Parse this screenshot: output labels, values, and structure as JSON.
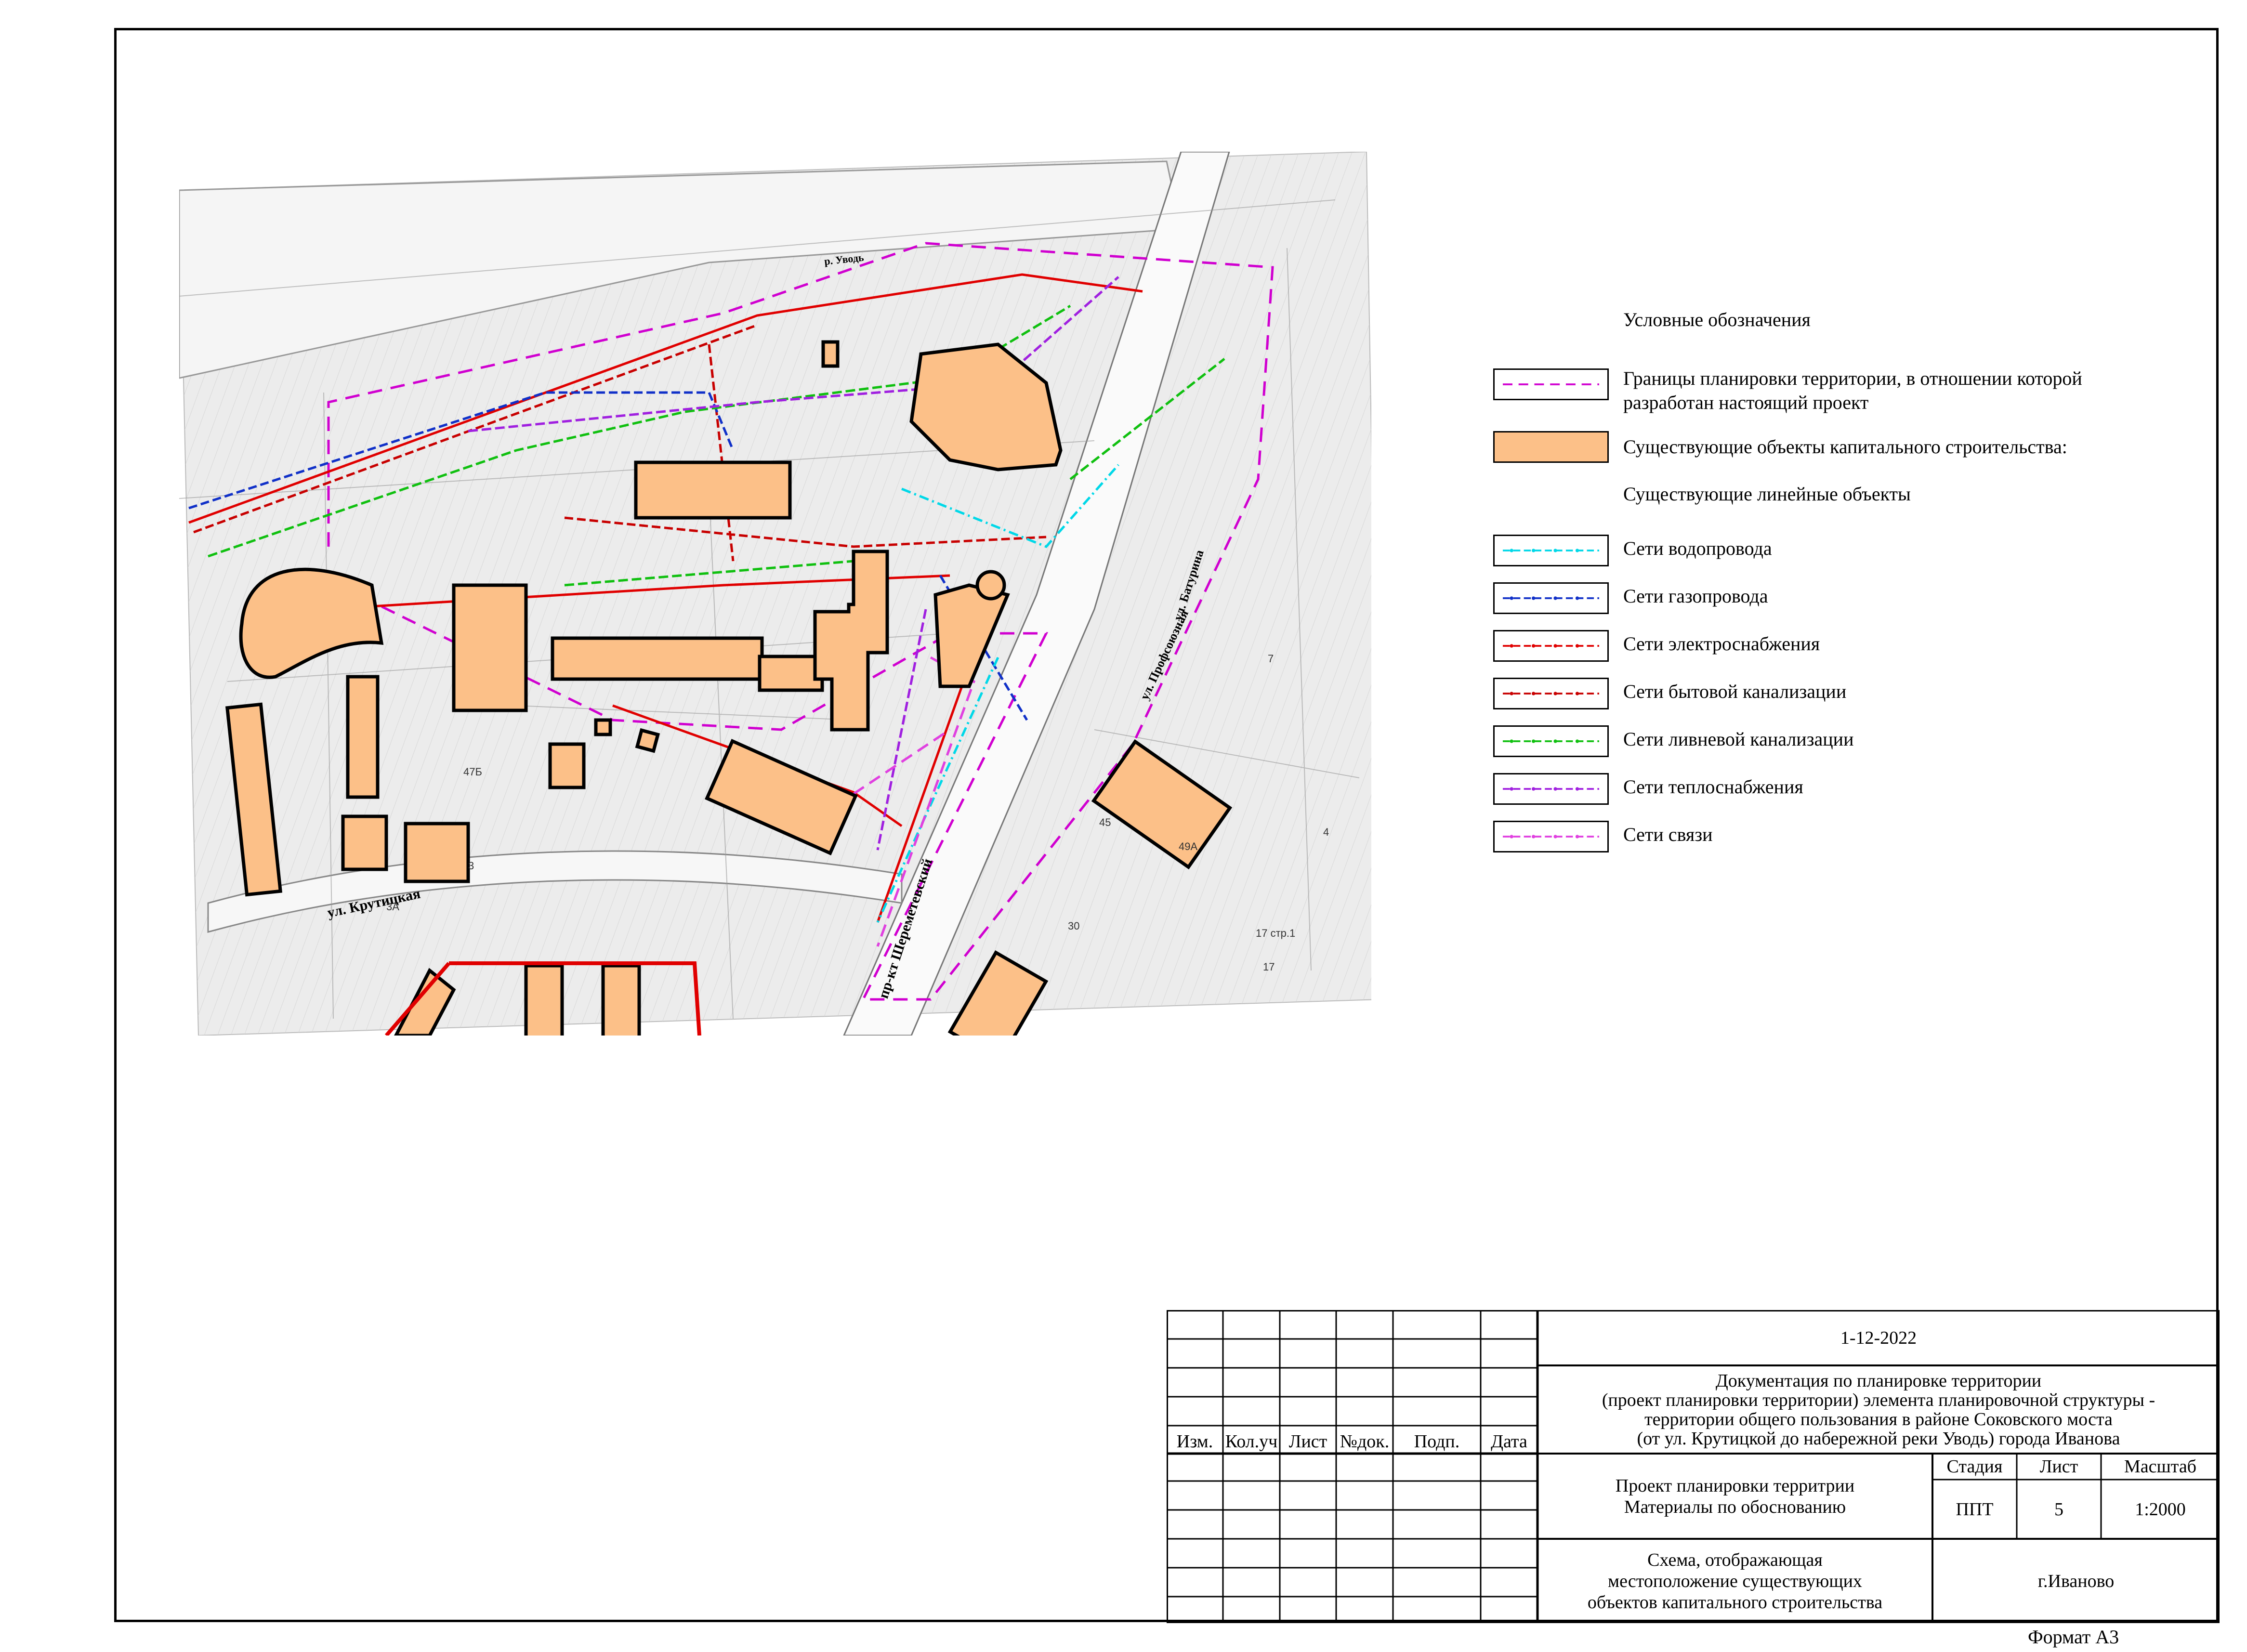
{
  "legend": {
    "title": "Условные обозначения",
    "items": [
      {
        "label": "Границы планировки территории, в отношении которой разработан настоящий проект",
        "style": "boundary",
        "color": "#d000d0"
      },
      {
        "label": "Существующие объекты капитального строительства:",
        "style": "fill",
        "color": "#fcc088"
      }
    ],
    "subtitle": "Существующие линейные объекты",
    "networks": [
      {
        "label": "Сети водопровода",
        "color": "#00d8e8"
      },
      {
        "label": "Сети газопровода",
        "color": "#1030c8"
      },
      {
        "label": "Сети электроснабжения",
        "color": "#e00000"
      },
      {
        "label": "Сети бытовой канализации",
        "color": "#c80000"
      },
      {
        "label": "Сети ливневой канализации",
        "color": "#10c010"
      },
      {
        "label": "Сети теплоснабжения",
        "color": "#a020e0"
      },
      {
        "label": "Сети связи",
        "color": "#e040e0"
      }
    ]
  },
  "map": {
    "streets": [
      "ул. Крутицкая",
      "пр-кт Шереметевский",
      "ул. Профсоюзная",
      "ул. Батурина",
      "р. Уводь"
    ],
    "house_numbers": [
      "47Б",
      "3",
      "3А",
      "45",
      "49А",
      "30",
      "7",
      "4",
      "17 стр.1",
      "17"
    ]
  },
  "stamp": {
    "code": "1-12-2022",
    "title": "Документация по планировке территории\n(проект планировки территории) элемента планировочной структуры -\nтерритории общего пользования в районе Соковского моста\n(от ул. Крутицкой до набережной реки Уводь) города Иванова",
    "headers": [
      "Изм.",
      "Кол.уч",
      "Лист",
      "№док.",
      "Подп.",
      "Дата"
    ],
    "project": "Проект планировки территрии\nМатериалы по обоснованию",
    "stage_label": "Стадия",
    "sheet_label": "Лист",
    "scale_label": "Масштаб",
    "stage": "ППТ",
    "sheet": "5",
    "scale": "1:2000",
    "drawing": "Схема, отображающая\nместоположение существующих\nобъектов капитального строительства",
    "city": "г.Иваново"
  },
  "format": "Формат А3"
}
